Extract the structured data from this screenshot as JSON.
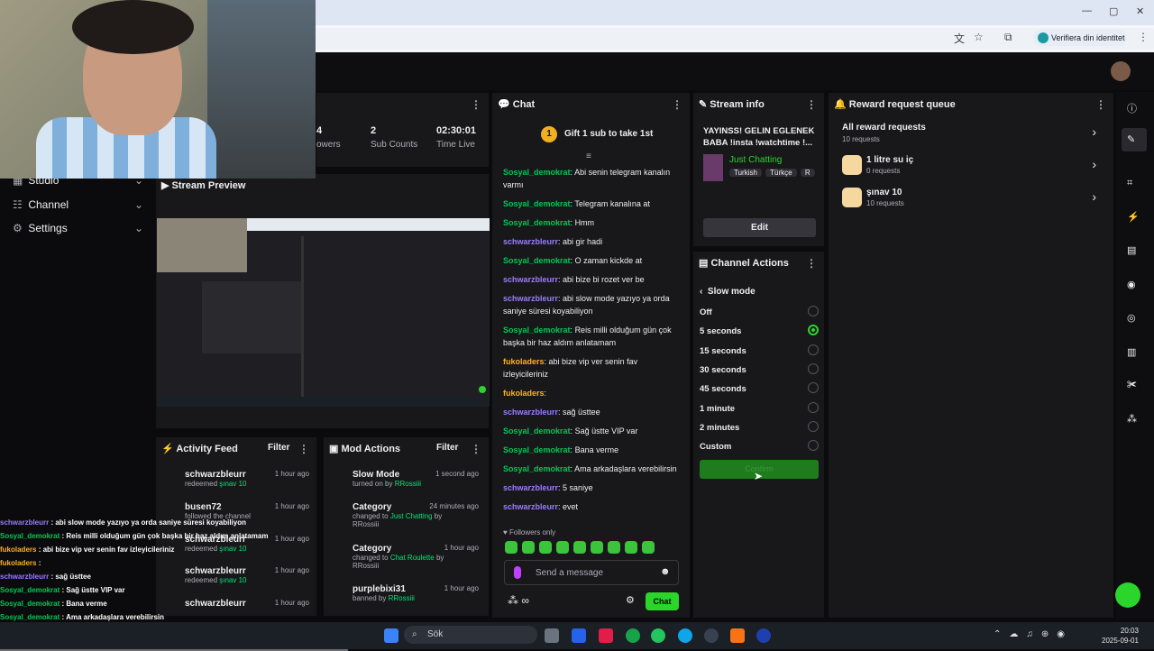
{
  "browser": {
    "verify_label": "Verifiera din identitet",
    "win_min": "—",
    "win_max": "▢",
    "win_close": "✕"
  },
  "sidebar": {
    "items": [
      {
        "label": "Studio",
        "icon": "▦"
      },
      {
        "label": "Channel",
        "icon": "☷"
      },
      {
        "label": "Settings",
        "icon": "⚙"
      }
    ]
  },
  "stats": [
    {
      "value": "4",
      "label": "owers"
    },
    {
      "value": "2",
      "label": "Sub Counts"
    },
    {
      "value": "02:30:01",
      "label": "Time Live"
    }
  ],
  "preview": {
    "title": "Stream Preview"
  },
  "activity_feed": {
    "title": "Activity Feed",
    "filter": "Filter",
    "rows": [
      {
        "name": "schwarzbleurr",
        "desc_prefix": "redeemed ",
        "desc_highlight": "şınav 10",
        "time": "1 hour ago"
      },
      {
        "name": "busen72",
        "desc_prefix": "followed the channel",
        "desc_highlight": "",
        "time": "1 hour ago"
      },
      {
        "name": "schwarzbleurr",
        "desc_prefix": "redeemed ",
        "desc_highlight": "şınav 10",
        "time": "1 hour ago"
      },
      {
        "name": "schwarzbleurr",
        "desc_prefix": "redeemed ",
        "desc_highlight": "şınav 10",
        "time": "1 hour ago"
      },
      {
        "name": "schwarzbleurr",
        "desc_prefix": "",
        "desc_highlight": "",
        "time": "1 hour ago"
      }
    ]
  },
  "mod_actions": {
    "title": "Mod Actions",
    "filter": "Filter",
    "rows": [
      {
        "name": "Slow Mode",
        "desc_prefix": "turned on by ",
        "desc_highlight": "RRossiii",
        "time": "1 second ago"
      },
      {
        "name": "Category",
        "desc_prefix": "changed to ",
        "desc_highlight": "Just Chatting",
        "desc_suffix": " by RRossiii",
        "time": "24 minutes ago"
      },
      {
        "name": "Category",
        "desc_prefix": "changed to ",
        "desc_highlight": "Chat Roulette",
        "desc_suffix": " by RRossiii",
        "time": "1 hour ago"
      },
      {
        "name": "purplebixi31",
        "desc_prefix": "banned by ",
        "desc_highlight": "RRossiii",
        "desc_suffix": "",
        "time": "1 hour ago"
      }
    ]
  },
  "chat": {
    "title": "Chat",
    "gift": "Gift 1 sub to take 1st",
    "gift_rank": "1",
    "messages": [
      {
        "user": "Sosyal_demokrat",
        "color": "u1",
        "text": "Abi senin telegram kanalın varmı"
      },
      {
        "user": "Sosyal_demokrat",
        "color": "u1",
        "text": "Telegram kanalına at"
      },
      {
        "user": "Sosyal_demokrat",
        "color": "u1",
        "text": "Hmm"
      },
      {
        "user": "schwarzbleurr",
        "color": "u2",
        "text": "abi gir hadi"
      },
      {
        "user": "Sosyal_demokrat",
        "color": "u1",
        "text": "O zaman kickde at"
      },
      {
        "user": "schwarzbleurr",
        "color": "u2",
        "text": "abi bize bi rozet ver be"
      },
      {
        "user": "schwarzbleurr",
        "color": "u2",
        "text": "abi slow mode yazıyo ya orda saniye süresi koyabiliyon"
      },
      {
        "user": "Sosyal_demokrat",
        "color": "u1",
        "text": "Reis milli olduğum gün çok başka bir haz aldım anlatamam"
      },
      {
        "user": "fukoladers",
        "color": "u3",
        "text": "abi bize vip ver senin fav izleyicileriniz"
      },
      {
        "user": "fukoladers",
        "color": "u3",
        "text": ""
      },
      {
        "user": "schwarzbleurr",
        "color": "u2",
        "text": "sağ üsttee"
      },
      {
        "user": "Sosyal_demokrat",
        "color": "u1",
        "text": "Sağ üstte VIP var"
      },
      {
        "user": "Sosyal_demokrat",
        "color": "u1",
        "text": "Bana verme"
      },
      {
        "user": "Sosyal_demokrat",
        "color": "u1",
        "text": "Ama arkadaşlara verebilirsin"
      },
      {
        "user": "schwarzbleurr",
        "color": "u2",
        "text": "5 saniye"
      },
      {
        "user": "schwarzbleurr",
        "color": "u2",
        "text": "evet"
      }
    ],
    "followers_only": "Followers only",
    "placeholder": "Send a message",
    "send_label": "Chat"
  },
  "stream_info": {
    "title": "Stream info",
    "stream_title": "YAYINSS! GELIN EGLENEK BABA !insta !watchtime !...",
    "category": "Just Chatting",
    "tags": [
      "Turkish",
      "Türkçe",
      "R"
    ],
    "edit": "Edit"
  },
  "channel_actions": {
    "title": "Channel Actions",
    "back_label": "Slow mode",
    "options": [
      {
        "label": "Off",
        "selected": false
      },
      {
        "label": "5 seconds",
        "selected": true
      },
      {
        "label": "15 seconds",
        "selected": false
      },
      {
        "label": "30 seconds",
        "selected": false
      },
      {
        "label": "45 seconds",
        "selected": false
      },
      {
        "label": "1 minute",
        "selected": false
      },
      {
        "label": "2 minutes",
        "selected": false
      },
      {
        "label": "Custom",
        "selected": false
      }
    ],
    "confirm": "Confirm"
  },
  "reward_queue": {
    "title": "Reward request queue",
    "all_label": "All reward requests",
    "all_count": "10 requests",
    "items": [
      {
        "name": "1 litre su iç",
        "count": "0 requests"
      },
      {
        "name": "şınav 10",
        "count": "10 requests"
      }
    ]
  },
  "overlay_chat": [
    {
      "user": "schwarzbleurr",
      "color": "u2",
      "text": " : abi slow mode yazıyo ya orda saniye süresi koyabiliyon"
    },
    {
      "user": "Sosyal_demokrat",
      "color": "u1",
      "text": " : Reis milli olduğum gün çok başka bir haz aldım anlatamam"
    },
    {
      "user": "fukoladers",
      "color": "u3",
      "text": " : abi bize vip ver senin fav izleyicileriniz"
    },
    {
      "user": "fukoladers",
      "color": "u3",
      "text": " : "
    },
    {
      "user": "schwarzbleurr",
      "color": "u2",
      "text": " : sağ üsttee"
    },
    {
      "user": "Sosyal_demokrat",
      "color": "u1",
      "text": " : Sağ üstte VIP var"
    },
    {
      "user": "Sosyal_demokrat",
      "color": "u1",
      "text": " : Bana verme"
    },
    {
      "user": "Sosyal_demokrat",
      "color": "u1",
      "text": " : Ama arkadaşlara verebilirsin"
    },
    {
      "user": "schwarzbleurr",
      "color": "u2",
      "text": " : 5 saniye"
    },
    {
      "user": "schwarzbleurr",
      "color": "u2",
      "text": " : evet"
    }
  ],
  "taskbar": {
    "search": "Sök",
    "time": "20:03",
    "date": "2025-09-01"
  },
  "colors": {
    "accent": "#2bd52b",
    "panel": "#18181b",
    "bg": "#0b0b0e"
  }
}
